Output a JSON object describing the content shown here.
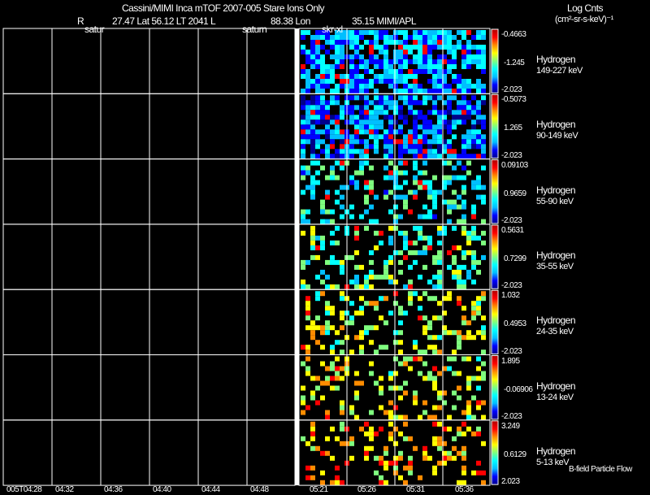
{
  "header": {
    "title": "Cassini/MIMI Inca mTOF  2007-005   Stare   Ions Only",
    "r_label": "R",
    "r_line": "27.47 Lat 56.12 LT 2041 L",
    "lon_line": "88.38 Lon",
    "lon_value_line": "35.15  MIMI/APL",
    "overlay_left": "satur",
    "overlay_mid": "saturn",
    "overlay_right": "skr-xl"
  },
  "units": {
    "line1": "Log Cnts",
    "line2": "(cm²-sr-s-keV)⁻¹"
  },
  "footer_note": "B-field Particle Flow",
  "chart_data": {
    "type": "heatmap",
    "x_ticks_left": [
      "005T04:28",
      "04:32",
      "04:36",
      "04:40",
      "04:44",
      "04:48"
    ],
    "x_ticks_right": [
      "05:21",
      "05:26",
      "05:31",
      "05:36"
    ],
    "panels": [
      {
        "species": "Hydrogen",
        "energy": "149-227 keV",
        "cbar_max": "-0.4663",
        "cbar_mid": "-1.245",
        "cbar_min": "-2.023"
      },
      {
        "species": "Hydrogen",
        "energy": "90-149 keV",
        "cbar_max": "-0.5073",
        "cbar_mid": "1.265",
        "cbar_min": "-2.023"
      },
      {
        "species": "Hydrogen",
        "energy": "55-90 keV",
        "cbar_max": "0.09103",
        "cbar_mid": "0.9659",
        "cbar_min": "-2.023"
      },
      {
        "species": "Hydrogen",
        "energy": "35-55 keV",
        "cbar_max": "0.5631",
        "cbar_mid": "0.7299",
        "cbar_min": "-2.023"
      },
      {
        "species": "Hydrogen",
        "energy": "24-35 keV",
        "cbar_max": "1.032",
        "cbar_mid": "0.4953",
        "cbar_min": "-2.023"
      },
      {
        "species": "Hydrogen",
        "energy": "13-24 keV",
        "cbar_max": "1.895",
        "cbar_mid": "-0.06906",
        "cbar_min": "-2.023"
      },
      {
        "species": "Hydrogen",
        "energy": "5-13 keV",
        "cbar_max": "3.249",
        "cbar_mid": "0.6129",
        "cbar_min": "2.023"
      }
    ],
    "colormap": [
      "#00008b",
      "#0000ff",
      "#00bfff",
      "#00ffff",
      "#7fff7f",
      "#ffff00",
      "#ff8c00",
      "#ff0000",
      "#b00000"
    ]
  }
}
